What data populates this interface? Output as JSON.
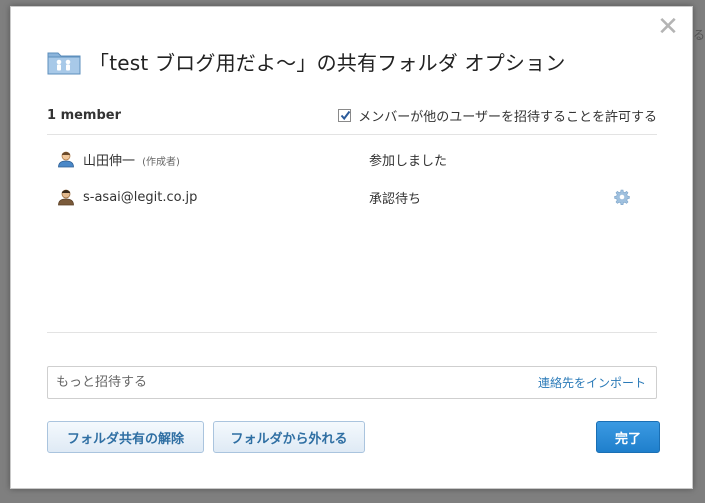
{
  "backdrop": {
    "right_fragment": "る",
    "bottom_fragment": "..."
  },
  "dialog": {
    "title": "「test ブログ用だよ〜」の共有フォルダ オプション",
    "close_label": "✕",
    "member_count": "1 member",
    "allow_invite_label": "メンバーが他のユーザーを招待することを許可する",
    "allow_invite_checked": true
  },
  "members": [
    {
      "name": "山田伸一",
      "tag": "(作成者)",
      "status": "参加しました",
      "icon": "user-avatar-icon"
    },
    {
      "name": "s-asai@legit.co.jp",
      "tag": "",
      "status": "承認待ち",
      "icon": "user-avatar-icon"
    }
  ],
  "invite": {
    "placeholder": "もっと招待する",
    "import_label": "連絡先をインポート"
  },
  "buttons": {
    "unshare": "フォルダ共有の解除",
    "leave": "フォルダから外れる",
    "done": "完了"
  },
  "colors": {
    "accent": "#1f7fcc",
    "link": "#2a7ab8"
  }
}
